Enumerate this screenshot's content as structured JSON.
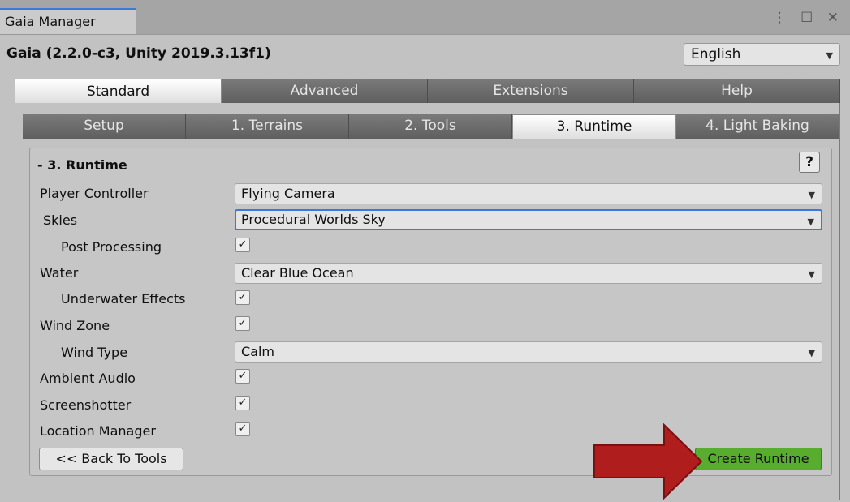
{
  "window": {
    "tab_title": "Gaia Manager",
    "controls": "⋮ ☐ ✕"
  },
  "header": {
    "title": "Gaia (2.2.0-c3, Unity 2019.3.13f1)",
    "language": "English"
  },
  "main_tabs": [
    {
      "label": "Standard",
      "active": true
    },
    {
      "label": "Advanced",
      "active": false
    },
    {
      "label": "Extensions",
      "active": false
    },
    {
      "label": "Help",
      "active": false
    }
  ],
  "sub_tabs": [
    {
      "label": "Setup",
      "active": false
    },
    {
      "label": "1. Terrains",
      "active": false
    },
    {
      "label": "2. Tools",
      "active": false
    },
    {
      "label": "3. Runtime",
      "active": true
    },
    {
      "label": "4. Light Baking",
      "active": false
    }
  ],
  "section": {
    "title": "- 3. Runtime",
    "help_label": "?"
  },
  "rows": {
    "player_controller": {
      "label": "Player Controller",
      "value": "Flying Camera"
    },
    "skies": {
      "label": "Skies",
      "value": "Procedural Worlds Sky"
    },
    "post_processing": {
      "label": "Post Processing",
      "checked": "✓"
    },
    "water": {
      "label": "Water",
      "value": "Clear Blue Ocean"
    },
    "underwater_effects": {
      "label": "Underwater Effects",
      "checked": "✓"
    },
    "wind_zone": {
      "label": "Wind Zone",
      "checked": "✓"
    },
    "wind_type": {
      "label": "Wind Type",
      "value": "Calm"
    },
    "ambient_audio": {
      "label": "Ambient Audio",
      "checked": "✓"
    },
    "screenshotter": {
      "label": "Screenshotter",
      "checked": "✓"
    },
    "location_manager": {
      "label": "Location Manager",
      "checked": "✓"
    }
  },
  "buttons": {
    "back": "<< Back To Tools",
    "create": "Create Runtime"
  },
  "dropdown_arrow": "▼",
  "colors": {
    "accent": "#3a7bd5",
    "create_button": "#58ad2f",
    "annotation_arrow": "#b01d1d"
  }
}
